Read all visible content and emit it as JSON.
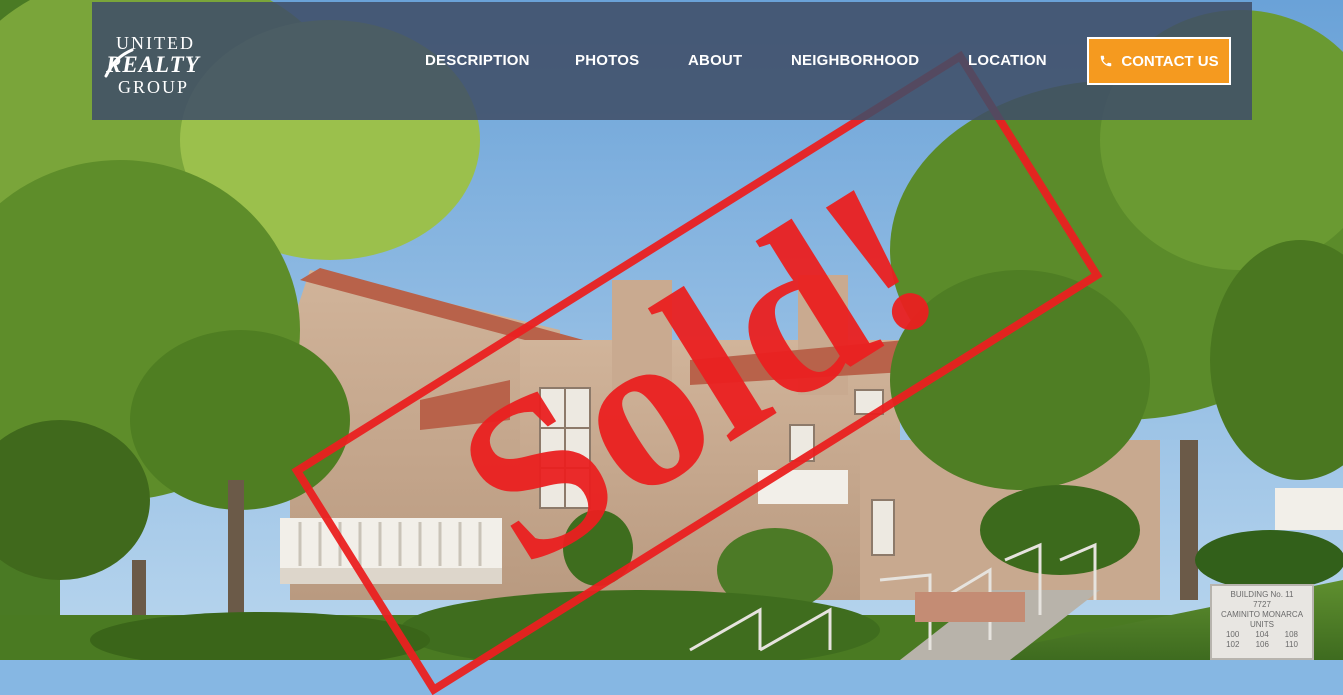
{
  "logo": {
    "line1": "UNITED",
    "line2": "REALTY",
    "line3": "GROUP"
  },
  "nav": {
    "items": [
      {
        "label": "DESCRIPTION"
      },
      {
        "label": "PHOTOS"
      },
      {
        "label": "ABOUT"
      },
      {
        "label": "NEIGHBORHOOD"
      },
      {
        "label": "LOCATION"
      }
    ],
    "contact_label": "CONTACT US",
    "contact_icon": "phone-icon"
  },
  "hero": {
    "stamp_text": "Sold!",
    "stamp_color": "#ea2020"
  },
  "sign": {
    "line1": "BUILDING No. 11",
    "line2": "7727",
    "line3": "CAMINITO MONARCA",
    "line4": "UNITS",
    "units_row1": [
      "100",
      "104",
      "108"
    ],
    "units_row2": [
      "102",
      "106",
      "110"
    ]
  },
  "colors": {
    "navbar_bg": "#404e68",
    "accent": "#f59a1f",
    "text": "#ffffff"
  }
}
